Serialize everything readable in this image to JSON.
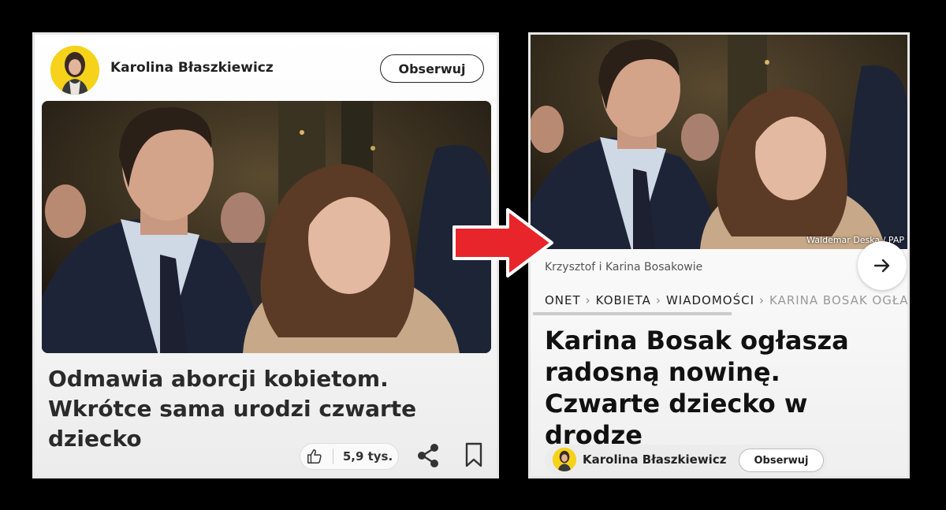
{
  "left_card": {
    "author": "Karolina Błaszkiewicz",
    "follow_label": "Obserwuj",
    "headline": "Odmawia aborcji kobietom. Wkrótce sama urodzi czwarte dziecko",
    "likes_count": "5,9 tys.",
    "icons": [
      "thumbs-up-icon",
      "share-icon",
      "bookmark-icon"
    ]
  },
  "arrow": {
    "color": "#e8252a",
    "icon": "right-arrow-icon"
  },
  "right_card": {
    "photo_credit": "Waldemar Deska / PAP",
    "caption": "Krzysztof i Karina Bosakowie",
    "breadcrumb": [
      "ONET",
      "KOBIETA",
      "WIADOMOŚCI",
      "KARINA BOSAK OGŁAS"
    ],
    "headline": "Karina Bosak ogłasza radosną nowinę. Czwarte dziecko w drodze",
    "author": "Karolina Błaszkiewicz",
    "follow_label": "Obserwuj",
    "icons": [
      "arrow-right-icon"
    ]
  },
  "colors": {
    "avatar_bg": "#f6d21a",
    "arrow": "#e8252a",
    "background": "#000000"
  }
}
